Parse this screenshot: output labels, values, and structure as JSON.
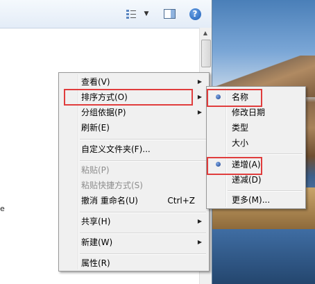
{
  "toolbar": {
    "views_icon": "views-icon",
    "dropdown_icon": "chevron-down-icon",
    "preview_pane_icon": "preview-pane-icon",
    "help_icon": "help-icon",
    "help_label": "?"
  },
  "content": {
    "left_edge_char": "e"
  },
  "context_menu": {
    "items": [
      {
        "label": "查看(V)",
        "has_submenu": true
      },
      {
        "label": "排序方式(O)",
        "has_submenu": true
      },
      {
        "label": "分组依据(P)",
        "has_submenu": true
      },
      {
        "label": "刷新(E)"
      },
      {
        "label": "自定义文件夹(F)..."
      },
      {
        "label": "粘贴(P)",
        "disabled": true
      },
      {
        "label": "粘贴快捷方式(S)",
        "disabled": true
      },
      {
        "label": "撤消 重命名(U)",
        "shortcut": "Ctrl+Z"
      },
      {
        "label": "共享(H)",
        "has_submenu": true
      },
      {
        "label": "新建(W)",
        "has_submenu": true
      },
      {
        "label": "属性(R)"
      }
    ],
    "arrow_glyph": "▶"
  },
  "sort_submenu": {
    "items": [
      {
        "label": "名称",
        "selected": true
      },
      {
        "label": "修改日期"
      },
      {
        "label": "类型"
      },
      {
        "label": "大小"
      },
      {
        "label": "递增(A)",
        "selected": true
      },
      {
        "label": "递减(D)"
      },
      {
        "label": "更多(M)..."
      }
    ]
  },
  "colors": {
    "highlight_border": "#e03c3c",
    "menu_background": "#f0f0f0"
  }
}
